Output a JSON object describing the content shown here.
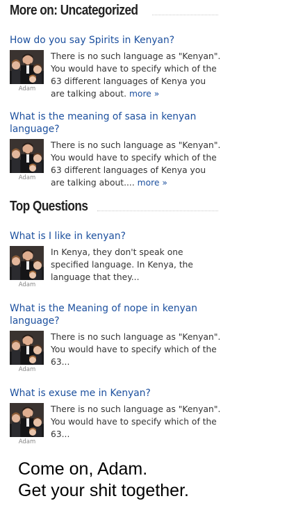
{
  "sections": {
    "uncategorized": {
      "title": "More on: Uncategorized"
    },
    "top": {
      "title": "Top Questions"
    }
  },
  "uncategorized_items": [
    {
      "question": "How do you say Spirits in Kenyan?",
      "author": "Adam",
      "answer": "There is no such language as \"Kenyan\". You would have to specify which of the 63 different languages of Kenya you are talking about.",
      "more": "more »"
    },
    {
      "question": "What is the meaning of sasa in kenyan language?",
      "author": "Adam",
      "answer": "There is no such language as \"Kenyan\". You would have to specify which of the 63 different languages of Kenya you are talking about....",
      "more": "more »"
    }
  ],
  "top_items": [
    {
      "question": "What is I like in kenyan?",
      "author": "Adam",
      "answer": "In Kenya, they don't speak one specified language. In Kenya, the language that they..."
    },
    {
      "question": "What is the Meaning of nope in kenyan language?",
      "author": "Adam",
      "answer": "There is no such language as \"Kenyan\". You would have to specify which of the 63..."
    },
    {
      "question": "What is exuse me in Kenyan?",
      "author": "Adam",
      "answer": "There is no such language as \"Kenyan\". You would have to specify which of the 63..."
    }
  ],
  "caption": {
    "line1": "Come on, Adam.",
    "line2": "Get your shit together."
  }
}
